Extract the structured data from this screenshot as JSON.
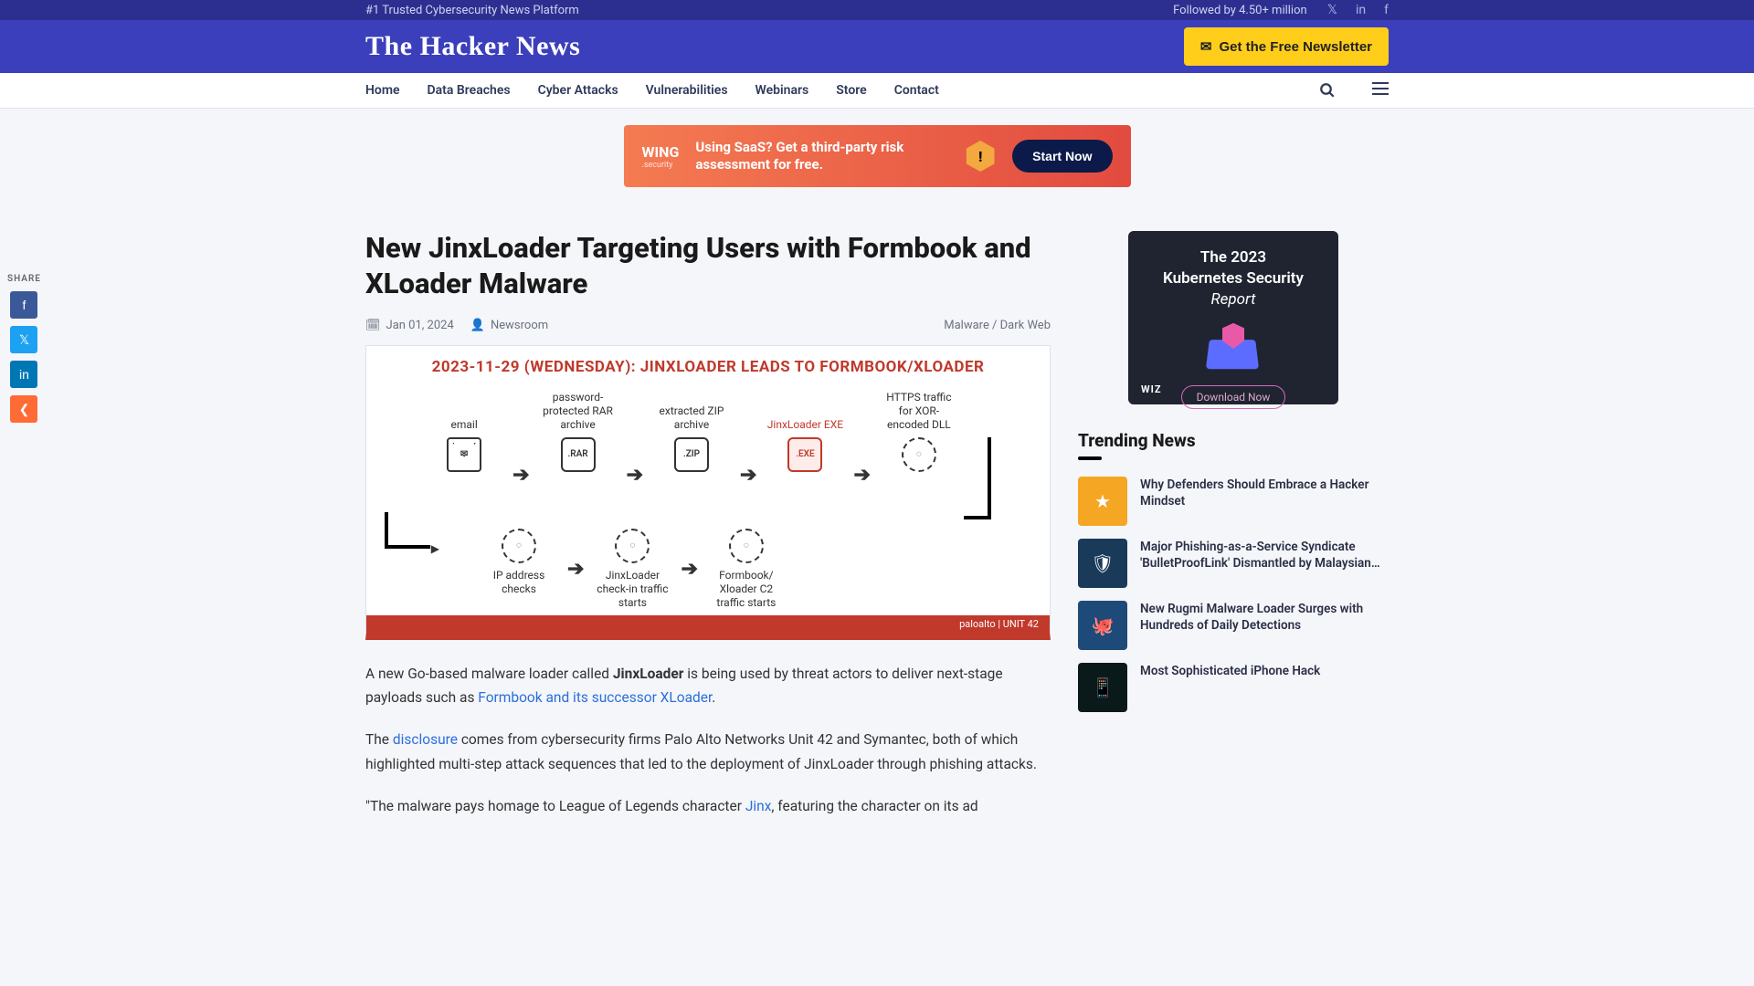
{
  "topbar": {
    "tagline": "#1 Trusted Cybersecurity News Platform",
    "followed": "Followed by 4.50+ million"
  },
  "header": {
    "logo": "The Hacker News",
    "newsletter_btn": "Get the Free Newsletter"
  },
  "nav": {
    "items": [
      "Home",
      "Data Breaches",
      "Cyber Attacks",
      "Vulnerabilities",
      "Webinars",
      "Store",
      "Contact"
    ]
  },
  "top_ad": {
    "brand": "WING",
    "brand_sub": ".security",
    "message": "Using SaaS? Get a third-party risk assessment for free.",
    "cta": "Start Now"
  },
  "article": {
    "title": "New JinxLoader Targeting Users with Formbook and XLoader Malware",
    "date": "Jan 01, 2024",
    "author": "Newsroom",
    "category": "Malware / Dark Web",
    "figure": {
      "title": "2023-11-29 (WEDNESDAY): JINXLOADER LEADS TO FORMBOOK/XLOADER",
      "nodes_top": [
        {
          "label": "email",
          "glyph": "✉",
          "type": "env"
        },
        {
          "label": "password-protected RAR archive",
          "glyph": ".RAR",
          "type": "file"
        },
        {
          "label": "extracted ZIP archive",
          "glyph": ".ZIP",
          "type": "file"
        },
        {
          "label": "JinxLoader EXE",
          "glyph": ".EXE",
          "type": "file",
          "red": true
        },
        {
          "label": "HTTPS traffic for XOR-encoded DLL",
          "glyph": "◌",
          "type": "gear"
        }
      ],
      "nodes_bottom": [
        {
          "label": "IP address checks",
          "glyph": "◌",
          "type": "gear"
        },
        {
          "label": "JinxLoader check-in traffic starts",
          "glyph": "◌",
          "type": "gear"
        },
        {
          "label": "Formbook/ Xloader C2 traffic starts",
          "glyph": "◌",
          "type": "gear"
        }
      ],
      "footer": "paloalto  |  UNIT 42"
    },
    "body": {
      "p1_pre": "A new Go-based malware loader called ",
      "p1_strong": "JinxLoader",
      "p1_mid": " is being used by threat actors to deliver next-stage payloads such as ",
      "p1_link": "Formbook and its successor XLoader",
      "p1_post": ".",
      "p2_pre": "The ",
      "p2_link": "disclosure",
      "p2_post": " comes from cybersecurity firms Palo Alto Networks Unit 42 and Symantec, both of which highlighted multi-step attack sequences that led to the deployment of JinxLoader through phishing attacks.",
      "p3_pre": "\"The malware pays homage to League of Legends character ",
      "p3_link": "Jinx",
      "p3_post": ", featuring the character on its ad"
    }
  },
  "share": {
    "label": "SHARE"
  },
  "side_ad": {
    "line1": "The 2023",
    "line2": "Kubernetes Security",
    "line3": "Report",
    "cta": "Download Now",
    "brand": "WIZ"
  },
  "trending": {
    "heading": "Trending News",
    "items": [
      "Why Defenders Should Embrace a Hacker Mindset",
      "Major Phishing-as-a-Service Syndicate 'BulletProofLink' Dismantled by Malaysian…",
      "New Rugmi Malware Loader Surges with Hundreds of Daily Detections",
      "Most Sophisticated iPhone Hack"
    ]
  }
}
